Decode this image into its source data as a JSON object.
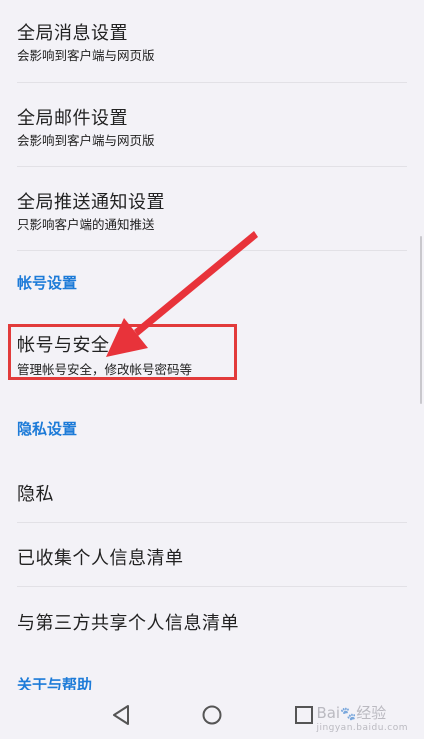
{
  "settings": {
    "global_message": {
      "title": "全局消息设置",
      "subtitle": "会影响到客户端与网页版"
    },
    "global_mail": {
      "title": "全局邮件设置",
      "subtitle": "会影响到客户端与网页版"
    },
    "global_push": {
      "title": "全局推送通知设置",
      "subtitle": "只影响客户端的通知推送"
    }
  },
  "account_section": {
    "header": "帐号设置",
    "security": {
      "title": "帐号与安全",
      "subtitle": "管理帐号安全，修改帐号密码等"
    }
  },
  "privacy_section": {
    "header": "隐私设置",
    "items": [
      {
        "label": "隐私"
      },
      {
        "label": "已收集个人信息清单"
      },
      {
        "label": "与第三方共享个人信息清单"
      }
    ]
  },
  "about_section": {
    "header": "关于与帮助"
  },
  "annotation": {
    "highlight_color": "#e23b3b",
    "arrow_color": "#e8333a"
  },
  "navbar": {
    "back": "back-icon",
    "home": "home-icon",
    "recents": "recents-icon"
  },
  "watermark": {
    "text": "Bai",
    "paw": "🐾",
    "text2": "经验",
    "sub": "jingyan.baidu.com"
  },
  "colors": {
    "background": "#f3f2f7",
    "accent": "#1d7bd8",
    "text": "#222222"
  }
}
